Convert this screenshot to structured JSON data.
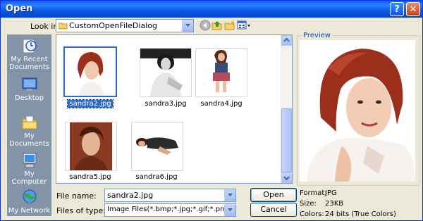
{
  "window": {
    "title": "Open",
    "help_glyph": "?",
    "close_glyph": "✕"
  },
  "look_in": {
    "label": "Look in:",
    "value": "CustomOpenFileDialog"
  },
  "toolbar_icons": [
    "back-icon",
    "up-folder-icon",
    "new-folder-icon",
    "views-menu-icon"
  ],
  "places": [
    {
      "label": "My Recent Documents",
      "icon": "recent-documents-icon"
    },
    {
      "label": "Desktop",
      "icon": "desktop-icon"
    },
    {
      "label": "My Documents",
      "icon": "my-documents-icon"
    },
    {
      "label": "My Computer",
      "icon": "my-computer-icon"
    },
    {
      "label": "My Network",
      "icon": "my-network-icon"
    }
  ],
  "files": [
    {
      "name": "sandra2.jpg",
      "selected": true
    },
    {
      "name": "sandra3.jpg",
      "selected": false
    },
    {
      "name": "sandra4.jpg",
      "selected": false
    },
    {
      "name": "sandra5.jpg",
      "selected": false
    },
    {
      "name": "sandra6.jpg",
      "selected": false
    }
  ],
  "file_name": {
    "label": "File name:",
    "value": "sandra2.jpg"
  },
  "files_of_type": {
    "label": "Files of type:",
    "value": "Image Files(*.bmp;*.jpg;*.gif;*.png)"
  },
  "buttons": {
    "open": "Open",
    "cancel": "Cancel"
  },
  "preview": {
    "legend": "Preview",
    "format_label": "Format:",
    "format_value": "JPG",
    "size_label": "Size:",
    "size_value": "23KB",
    "colors_label": "Colors:",
    "colors_value": "24 bits (True Colors)"
  },
  "colors": {
    "title_bar": "#0a57e8",
    "selection": "#316ac5",
    "places_bar": "#8393a8",
    "preview_legend": "#0046d5"
  }
}
